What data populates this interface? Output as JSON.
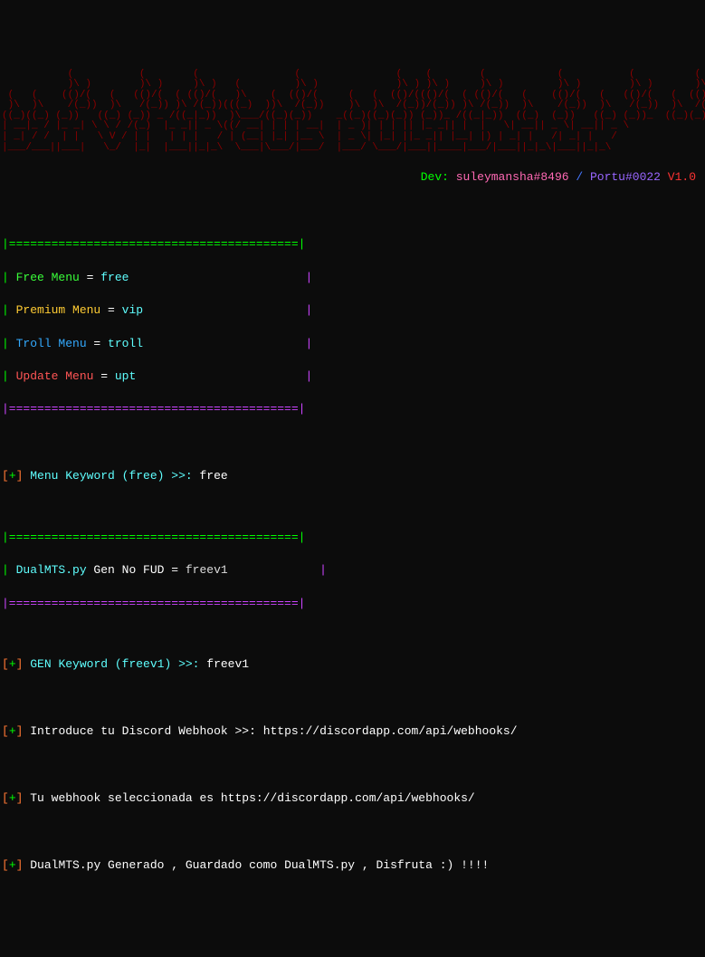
{
  "ascii_art": "           (           (        (                (                (    (        (            (           (          (         (    \n           )\\ )        )\\ )     )\\ )   (         )\\ )             )\\ ) )\\ )     )\\ )         )\\ )        )\\ )       )\\ )      )\\ ) \n (   (    (()/(   (   (()/(  ( (()/(   )\\    (  (()/(     (   (  (()/((()/(  ( (()/(   (    (()/(   (   (()/(   (  (()/(   (  (()/( \n )\\  )\\    /(_))  )\\   /(_)) )\\ /(_))(((_)  ))\\  /(_))    )\\  )\\  /(_))/(_)) )\\ /(_))  )\\    /(_))  )\\   /(_))  )\\  /(_))  )\\  /(_))\n((_)((_) (_))   ((_) (_)) _ /((_|_))  )\\___/((_)(_))    _((_)((_)(_)) (_))_ /((_|_))  ((_)  (_))   ((_) (_))_  ((_)(_))   ((_)(_))  \n| __|_ / |_ _| \\ \\ / /(_)  |_ _|| _ \\((/ __| | | | __|  | _ )| | | || |_ _|| |  |   \\| __|| _ \\| __|| _ \\   \n| _| / /  | |   \\ V / | |   | | |   / | (__| |_| |__ \\  | _ \\| |_| ||_ _|| |__| |) | _| |   /| _| |   /   \n|___/___||___|   \\_/  |_|  |___||_|_\\  \\___|\\___/|___/  |___/ \\___/|___||____|___/|___||_|_\\|___||_|_\\   ",
  "credits": {
    "dev_label": "Dev: ",
    "dev1": "suleymansha#8496",
    "slash": " / ",
    "dev2": "Portu#0022",
    "version": " V1.0"
  },
  "separator_green": "|=========================================|",
  "separator_purple": "|=========================================|",
  "menu": {
    "free": {
      "label": "Free Menu",
      "keyword": "free"
    },
    "premium": {
      "label": "Premium Menu",
      "keyword": "vip"
    },
    "troll": {
      "label": "Troll Menu",
      "keyword": "troll"
    },
    "update": {
      "label": "Update Menu",
      "keyword": "upt"
    }
  },
  "prompt1": {
    "prefix": "[+]",
    "text": " Menu Keyword (free) >>: ",
    "input": "free"
  },
  "submenu": {
    "item": "DualMTS.py",
    "gen": " Gen ",
    "nofud": "No FUD",
    "eq": " = ",
    "keyword": "freev1"
  },
  "prompt2": {
    "prefix": "[+]",
    "text": " GEN Keyword (freev1) >>: ",
    "input": "freev1"
  },
  "prompt3": {
    "prefix": "[+]",
    "text": " Introduce tu Discord Webhook >>: ",
    "input": "https://discordapp.com/api/webhooks/"
  },
  "msg1": {
    "prefix": "[+]",
    "text": " Tu webhook seleccionada es https://discordapp.com/api/webhooks/"
  },
  "msg2": {
    "prefix": "[+]",
    "text": " DualMTS.py Generado , Guardado como DualMTS.py , Disfruta :) !!!!"
  }
}
